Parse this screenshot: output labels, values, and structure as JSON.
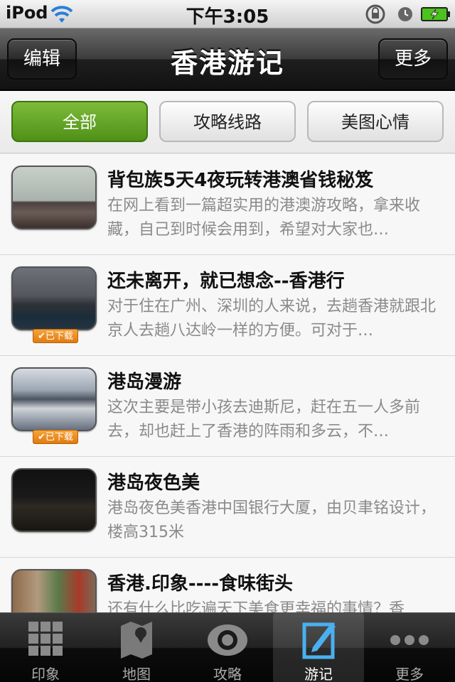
{
  "statusbar": {
    "carrier": "iPod",
    "time": "下午3:05"
  },
  "navbar": {
    "title": "香港游记",
    "edit_label": "编辑",
    "more_label": "更多"
  },
  "filters": {
    "all": "全部",
    "routes": "攻略线路",
    "photos": "美图心情",
    "selected": "全部"
  },
  "list": [
    {
      "title": "背包族5天4夜玩转港澳省钱秘笈",
      "desc": "在网上看到一篇超实用的港澳游攻略，拿来收藏，自己到时候会用到，希望对大家也…",
      "badge": ""
    },
    {
      "title": "还未离开，就已想念--香港行",
      "desc": "对于住在广州、深圳的人来说，去趟香港就跟北京人去趟八达岭一样的方便。可对于…",
      "badge": "✔已下载"
    },
    {
      "title": "港岛漫游",
      "desc": "这次主要是带小孩去迪斯尼，赶在五一人多前去，却也赶上了香港的阵雨和多云，不…",
      "badge": "✔已下载"
    },
    {
      "title": "港岛夜色美",
      "desc": "港岛夜色美香港中国银行大厦，由贝聿铭设计，楼高315米",
      "badge": ""
    },
    {
      "title": "香港.印象----食味街头",
      "desc": "还有什么比吃遍天下美食更幸福的事情？香",
      "badge": ""
    }
  ],
  "tabbar": {
    "items": [
      {
        "label": "印象",
        "icon": "grid-icon"
      },
      {
        "label": "地图",
        "icon": "map-pin-icon"
      },
      {
        "label": "攻略",
        "icon": "eye-icon"
      },
      {
        "label": "游记",
        "icon": "edit-note-icon"
      },
      {
        "label": "更多",
        "icon": "more-dots-icon"
      }
    ],
    "active": "游记"
  },
  "colors": {
    "accent_green": "#5da021",
    "badge_orange": "#f08a1e",
    "wifi_blue": "#2a7fd8"
  }
}
